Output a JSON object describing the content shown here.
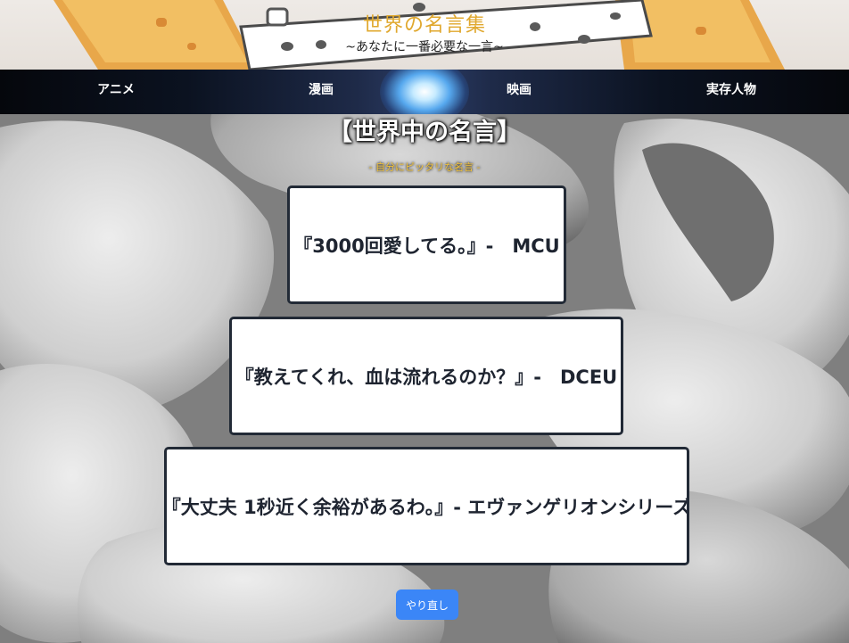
{
  "header": {
    "title": "世界の名言集",
    "subtitle": "~あなたに一番必要な一言~"
  },
  "nav": {
    "items": [
      {
        "label": "アニメ"
      },
      {
        "label": "漫画"
      },
      {
        "label": "映画"
      },
      {
        "label": "実存人物"
      }
    ]
  },
  "section": {
    "title": "【世界中の名言】",
    "subtitle": "- 自分にピッタリな名言 -"
  },
  "quotes": [
    {
      "text": "『3000回愛してる。』-　MCU"
    },
    {
      "text": "『教えてくれ、血は流れるのか？』-　DCEU"
    },
    {
      "text": "『大丈夫 1秒近く余裕があるわ。』- エヴァンゲリオンシリーズ"
    }
  ],
  "actions": {
    "retry_label": "やり直し"
  },
  "colors": {
    "title_gold": "#e0a82e",
    "subtitle_gold": "#f2c33c",
    "button_blue": "#3b86f7",
    "card_border": "#222a36"
  }
}
